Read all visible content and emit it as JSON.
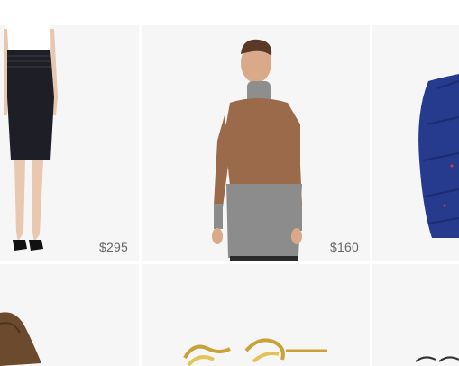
{
  "products": [
    {
      "name": "pencil-skirt",
      "price": "$295"
    },
    {
      "name": "two-tone-turtleneck-sweater",
      "price": "$160"
    },
    {
      "name": "navy-puffer-jacket",
      "price": ""
    },
    {
      "name": "brown-leather-item",
      "price": ""
    },
    {
      "name": "gold-chain-earrings",
      "price": ""
    },
    {
      "name": "partial-item",
      "price": ""
    }
  ],
  "colors": {
    "tile_background": "#f6f6f6",
    "price_text": "#666666"
  }
}
